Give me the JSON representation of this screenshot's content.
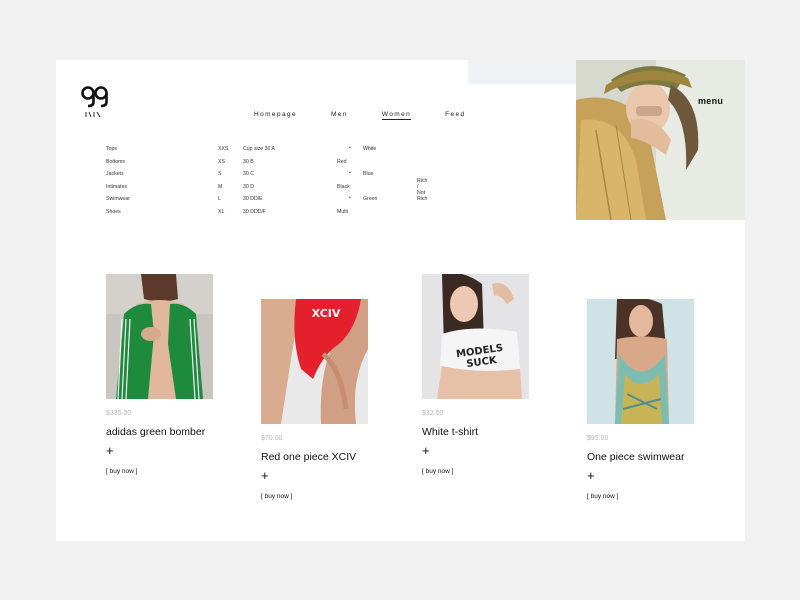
{
  "header": {
    "menu_label": "menu",
    "nav": [
      "Homepage",
      "Men",
      "Women",
      "Feed"
    ],
    "active_nav": "Women"
  },
  "filters": {
    "categories": [
      "Tops",
      "Bottoms",
      "Jackets",
      "Intimates",
      "Swimwear",
      "Shoes"
    ],
    "sizes": [
      "XXS",
      "XS",
      "S",
      "M",
      "L",
      "XL"
    ],
    "cup_sizes": [
      "Cup size 30 A",
      "30 B",
      "30 C",
      "30 D",
      "30 DD/E",
      "30 DDD/F"
    ],
    "colors_left": [
      "Red",
      "Black",
      "Multi"
    ],
    "colors_right": [
      "White",
      "Blue",
      "Green"
    ],
    "rich": "Rich / Not Rich"
  },
  "products": [
    {
      "price": "$335.00",
      "name": "adidas green bomber",
      "plus": "+",
      "buy": "[ buy now ]"
    },
    {
      "price": "$70.00",
      "name": "Red one piece XCIV",
      "plus": "+",
      "buy": "[ buy now ]"
    },
    {
      "price": "$32.00",
      "name": "White t-shirt",
      "plus": "+",
      "buy": "[ buy now ]"
    },
    {
      "price": "$95.00",
      "name": "One piece swimwear",
      "plus": "+",
      "buy": "[ buy now ]"
    }
  ],
  "photo_text": {
    "red_suit": "XCIV",
    "tshirt_line1": "MODELS",
    "tshirt_line2": "SUCK"
  },
  "colors": {
    "page_bg": "#f1f1f1",
    "card_bg": "#ffffff",
    "price": "#b5b5b5",
    "text": "#111111"
  }
}
